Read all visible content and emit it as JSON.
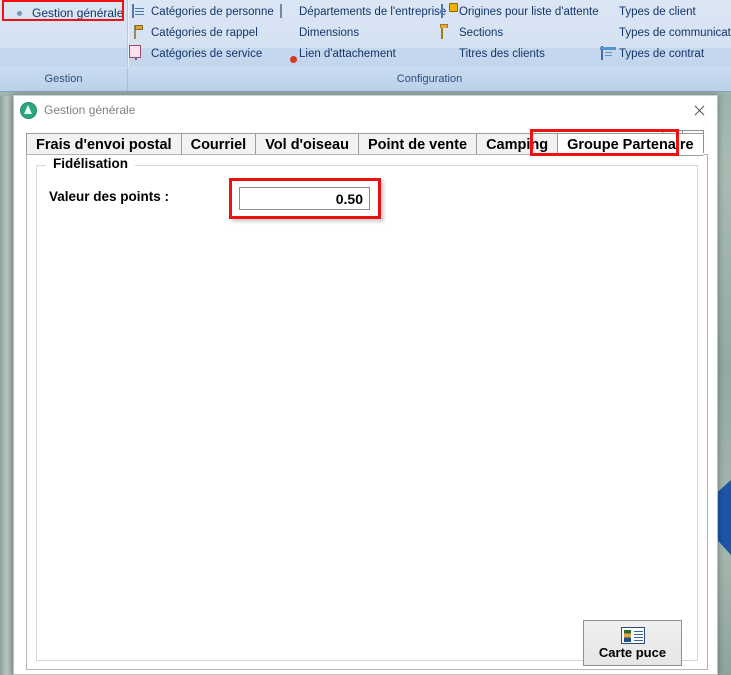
{
  "ribbon": {
    "groups": [
      {
        "name": "Gestion",
        "label": "Gestion"
      },
      {
        "name": "Configuration",
        "label": "Configuration"
      }
    ],
    "gestion": {
      "main_button": {
        "label": "Gestion générale",
        "icon": "gear-icon",
        "highlighted": true
      }
    },
    "configuration": {
      "column1": [
        {
          "label": "Catégories de personne",
          "icon": "list-icon"
        },
        {
          "label": "Catégories de rappel",
          "icon": "clipboard-icon"
        },
        {
          "label": "Catégories de service",
          "icon": "copy-icon"
        }
      ],
      "column2": [
        {
          "label": "Départements de l'entreprise",
          "icon": "departments-icon"
        },
        {
          "label": "Dimensions",
          "icon": "grid-icon"
        },
        {
          "label": "Lien d'attachement",
          "icon": "attachment-person-icon"
        }
      ],
      "column3": [
        {
          "label": "Origines pour liste d'attente",
          "icon": "origins-icon"
        },
        {
          "label": "Sections",
          "icon": "folder-icon"
        },
        {
          "label": "Titres des clients",
          "icon": "people-icon"
        }
      ],
      "column4": [
        {
          "label": "Types de client",
          "icon": "people-red-icon"
        },
        {
          "label": "Types de communication",
          "icon": "communication-icon"
        },
        {
          "label": "Types de contrat",
          "icon": "contract-icon"
        }
      ]
    }
  },
  "dialog": {
    "title": "Gestion générale",
    "app_icon": "green-triangle-icon",
    "close_label": "✕",
    "tabs": [
      {
        "label": "Frais d'envoi postal",
        "active": false
      },
      {
        "label": "Courriel",
        "active": false
      },
      {
        "label": "Vol d'oiseau",
        "active": false
      },
      {
        "label": "Point de vente",
        "active": false
      },
      {
        "label": "Camping",
        "active": false
      },
      {
        "label": "Groupe Partenaire",
        "active": true
      }
    ],
    "tab_scroll": {
      "prev": "◄",
      "next": "►"
    },
    "page": {
      "fieldset_legend": "Fidélisation",
      "field_label": "Valeur des points :",
      "field_value": "0.50",
      "field_placeholder": "",
      "carte_puce_button": {
        "label": "Carte puce",
        "icon": "id-card-icon"
      }
    }
  },
  "highlights": {
    "accent_color": "#ee1111"
  }
}
